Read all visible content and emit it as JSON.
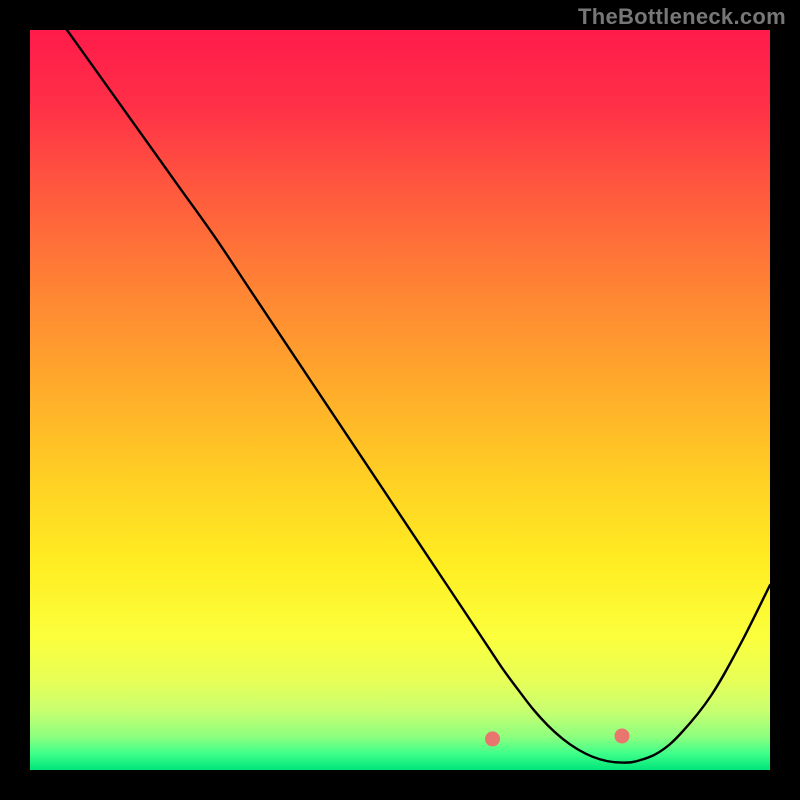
{
  "attribution": "TheBottleneck.com",
  "chart_data": {
    "type": "line",
    "title": "",
    "xlabel": "",
    "ylabel": "",
    "x_range": [
      0,
      100
    ],
    "y_range": [
      0,
      100
    ],
    "series": [
      {
        "name": "curve",
        "x": [
          5,
          10,
          15,
          20,
          25,
          30,
          35,
          40,
          45,
          50,
          55,
          60,
          62,
          64,
          66,
          68,
          70,
          72,
          74,
          76,
          78,
          80,
          82,
          85,
          88,
          92,
          96,
          100
        ],
        "y": [
          100,
          93,
          86,
          79,
          72,
          64.5,
          57,
          49.5,
          42,
          34.5,
          27,
          19.5,
          16.5,
          13.5,
          10.8,
          8.2,
          6.0,
          4.2,
          2.8,
          1.8,
          1.2,
          1.0,
          1.2,
          2.4,
          5.0,
          10.0,
          17.0,
          25.0
        ]
      }
    ],
    "markers": {
      "dots": [
        {
          "x": 62.5,
          "y": 4.2
        },
        {
          "x": 80.0,
          "y": 4.6
        }
      ],
      "pills": [
        {
          "x1": 64.0,
          "y1": 3.2,
          "x2": 67.5,
          "y2": 2.4
        },
        {
          "x1": 68.5,
          "y1": 2.2,
          "x2": 71.5,
          "y2": 2.0
        },
        {
          "x1": 72.5,
          "y1": 2.0,
          "x2": 73.8,
          "y2": 2.0
        },
        {
          "x1": 74.5,
          "y1": 2.0,
          "x2": 77.5,
          "y2": 2.2
        },
        {
          "x1": 78.0,
          "y1": 2.4,
          "x2": 79.0,
          "y2": 2.8
        },
        {
          "x1": 81.0,
          "y1": 5.4,
          "x2": 82.5,
          "y2": 6.6
        }
      ]
    },
    "gradient_stops": [
      {
        "offset": 0.0,
        "color": "#ff1b4b"
      },
      {
        "offset": 0.1,
        "color": "#ff2f47"
      },
      {
        "offset": 0.22,
        "color": "#ff5a3e"
      },
      {
        "offset": 0.35,
        "color": "#ff8434"
      },
      {
        "offset": 0.48,
        "color": "#ffaa2b"
      },
      {
        "offset": 0.6,
        "color": "#ffce24"
      },
      {
        "offset": 0.72,
        "color": "#ffed22"
      },
      {
        "offset": 0.82,
        "color": "#fbff3c"
      },
      {
        "offset": 0.88,
        "color": "#e7ff58"
      },
      {
        "offset": 0.92,
        "color": "#c8ff70"
      },
      {
        "offset": 0.955,
        "color": "#8dff7e"
      },
      {
        "offset": 0.978,
        "color": "#3eff8a"
      },
      {
        "offset": 1.0,
        "color": "#00e57a"
      }
    ]
  }
}
